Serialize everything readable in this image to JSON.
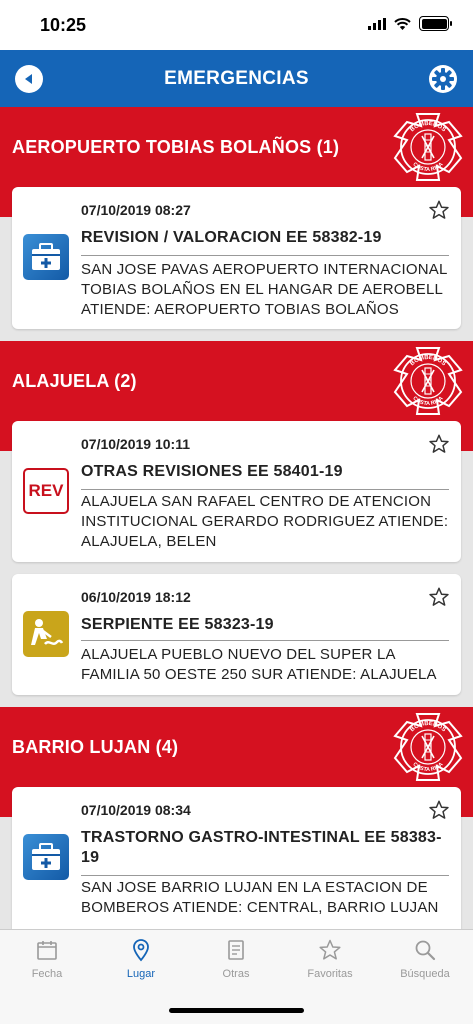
{
  "status": {
    "time": "10:25"
  },
  "nav": {
    "title": "EMERGENCIAS"
  },
  "sections": [
    {
      "title": "AEROPUERTO TOBIAS BOLAÑOS (1)",
      "cards": [
        {
          "date": "07/10/2019 08:27",
          "title": "REVISION / VALORACION EE 58382-19",
          "desc": "SAN JOSE PAVAS AEROPUERTO INTERNACIONAL TOBIAS BOLAÑOS EN EL HANGAR DE AEROBELL ATIENDE: AEROPUERTO TOBIAS BOLAÑOS",
          "icon": "medical-kit-icon"
        }
      ]
    },
    {
      "title": "ALAJUELA (2)",
      "cards": [
        {
          "date": "07/10/2019 10:11",
          "title": "OTRAS REVISIONES EE 58401-19",
          "desc": "ALAJUELA SAN RAFAEL CENTRO DE ATENCION INSTITUCIONAL GERARDO RODRIGUEZ ATIENDE: ALAJUELA, BELEN",
          "icon": "rev-badge-icon",
          "icon_text": "REV"
        },
        {
          "date": "06/10/2019 18:12",
          "title": "SERPIENTE EE 58323-19",
          "desc": "ALAJUELA PUEBLO NUEVO DEL SUPER LA FAMILIA 50 OESTE 250 SUR ATIENDE: ALAJUELA",
          "icon": "snake-rescue-icon"
        }
      ]
    },
    {
      "title": "BARRIO LUJAN (4)",
      "cards": [
        {
          "date": "07/10/2019 08:34",
          "title": "TRASTORNO GASTRO-INTESTINAL EE 58383-19",
          "desc": "SAN JOSE BARRIO LUJAN EN LA ESTACION DE BOMBEROS ATIENDE: CENTRAL, BARRIO LUJAN",
          "icon": "medical-kit-icon"
        }
      ]
    }
  ],
  "logo": {
    "top_text": "BOMBEROS",
    "bottom_text": "COSTA RICA"
  },
  "tabs": [
    {
      "label": "Fecha",
      "icon": "calendar-icon"
    },
    {
      "label": "Lugar",
      "icon": "location-pin-icon",
      "active": true
    },
    {
      "label": "Otras",
      "icon": "document-icon"
    },
    {
      "label": "Favoritas",
      "icon": "star-icon"
    },
    {
      "label": "Búsqueda",
      "icon": "search-icon"
    }
  ],
  "colors": {
    "brand_blue": "#1565b7",
    "section_red": "#d51120",
    "background": "#e6e6e6"
  }
}
